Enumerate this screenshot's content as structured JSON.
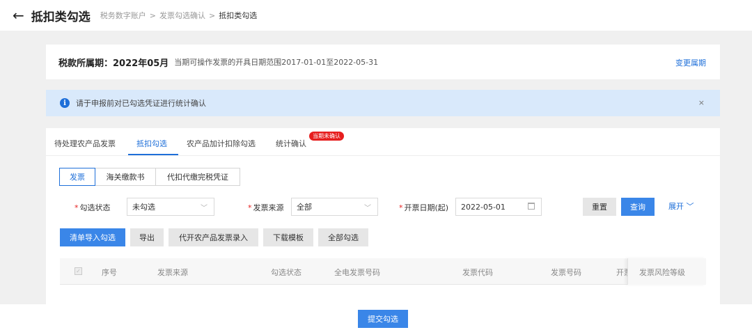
{
  "header": {
    "back_glyph": "←",
    "title": "抵扣类勾选",
    "breadcrumb": [
      "税务数字账户",
      "发票勾选确认",
      "抵扣类勾选"
    ],
    "separator": ">"
  },
  "period": {
    "label": "税款所属期：",
    "value": "2022年05月",
    "description": "当期可操作发票的开具日期范围2017-01-01至2022-05-31",
    "change_link": "变更属期"
  },
  "notice": {
    "icon": "info-icon",
    "message": "请于申报前对已勾选凭证进行统计确认",
    "close": "×"
  },
  "tabs": {
    "items": [
      "待处理农产品发票",
      "抵扣勾选",
      "农产品加计扣除勾选",
      "统计确认"
    ],
    "active_index": 1,
    "badge": "当期未确认"
  },
  "subtabs": {
    "items": [
      "发票",
      "海关缴款书",
      "代扣代缴完税凭证"
    ],
    "active_index": 0
  },
  "filters": {
    "status": {
      "label": "勾选状态",
      "value": "未勾选"
    },
    "source": {
      "label": "发票来源",
      "value": "全部"
    },
    "date": {
      "label": "开票日期(起)",
      "value": "2022-05-01"
    },
    "required_mark": "*",
    "reset": "重置",
    "query": "查询",
    "expand": "展开"
  },
  "actions": [
    "清单导入勾选",
    "导出",
    "代开农产品发票录入",
    "下载模板",
    "全部勾选"
  ],
  "table": {
    "columns": [
      "序号",
      "发票来源",
      "勾选状态",
      "全电发票号码",
      "发票代码",
      "发票号码",
      "开票",
      "发票风险等级"
    ]
  },
  "footer": {
    "submit": "提交勾选"
  },
  "colors": {
    "primary": "#3a86e8",
    "link": "#1e6fd9",
    "badge": "#e61e1e",
    "notice_bg": "#d9e9fb"
  }
}
